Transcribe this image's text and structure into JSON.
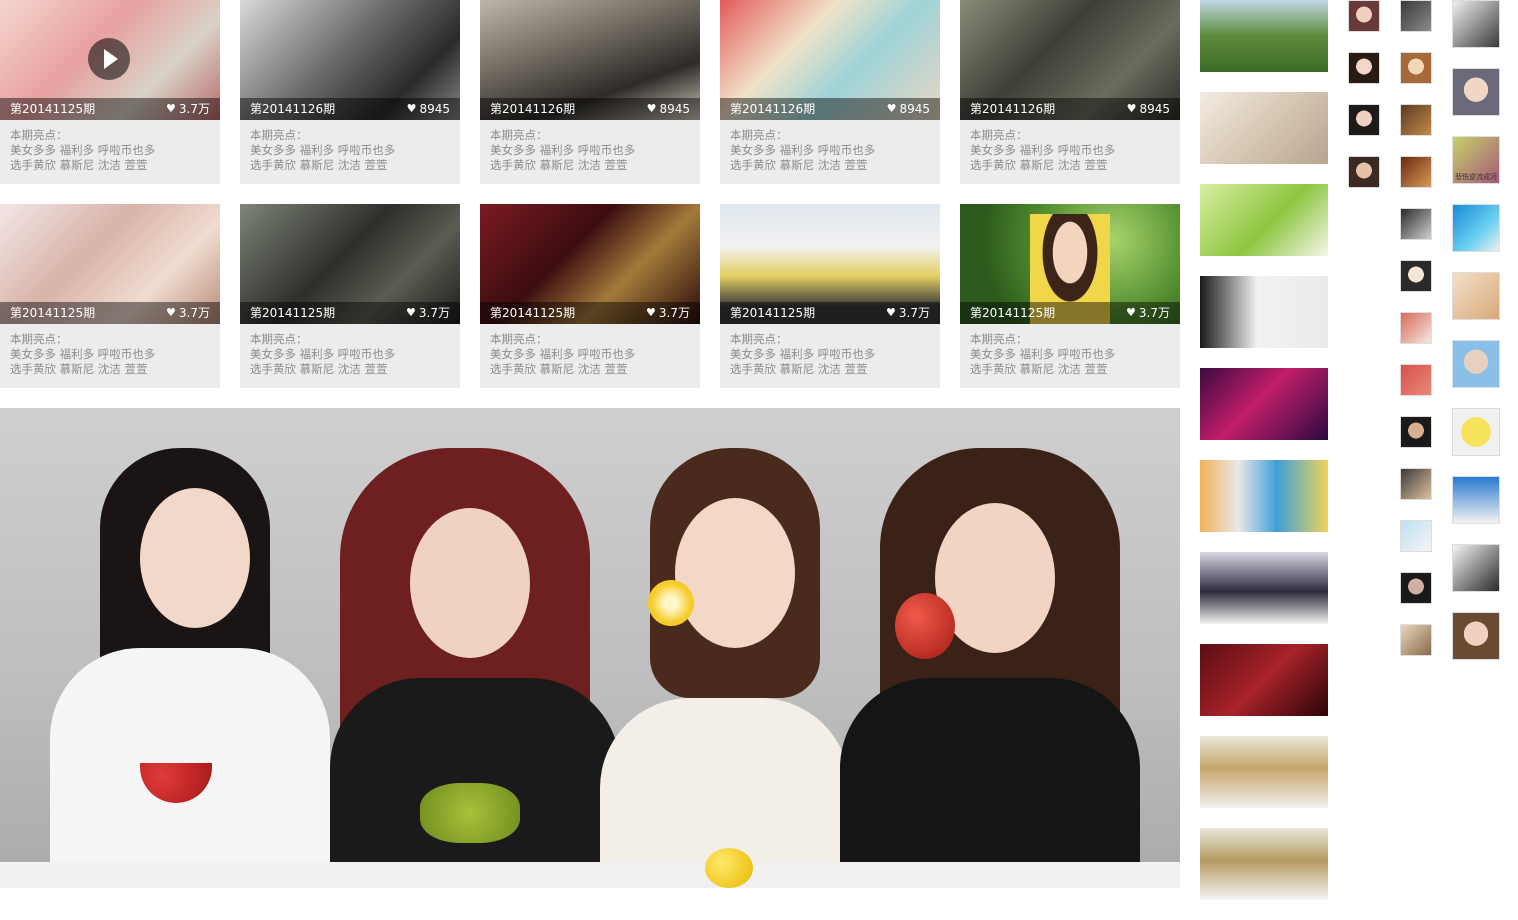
{
  "grid": {
    "row1": [
      {
        "episode": "第20141125期",
        "likes": "3.7万",
        "desc_title": "本期亮点：",
        "desc_line1": "美女多多 福利多 呼啦币也多",
        "desc_line2": "选手黄欣 慕斯尼 沈洁 萱萱",
        "has_play": true
      },
      {
        "episode": "第20141126期",
        "likes": "8945",
        "desc_title": "本期亮点：",
        "desc_line1": "美女多多 福利多 呼啦币也多",
        "desc_line2": "选手黄欣 慕斯尼 沈洁 萱萱",
        "has_play": false
      },
      {
        "episode": "第20141126期",
        "likes": "8945",
        "desc_title": "本期亮点：",
        "desc_line1": "美女多多 福利多 呼啦币也多",
        "desc_line2": "选手黄欣 慕斯尼 沈洁 萱萱",
        "has_play": false
      },
      {
        "episode": "第20141126期",
        "likes": "8945",
        "desc_title": "本期亮点：",
        "desc_line1": "美女多多 福利多 呼啦币也多",
        "desc_line2": "选手黄欣 慕斯尼 沈洁 萱萱",
        "has_play": false
      },
      {
        "episode": "第20141126期",
        "likes": "8945",
        "desc_title": "本期亮点：",
        "desc_line1": "美女多多 福利多 呼啦币也多",
        "desc_line2": "选手黄欣 慕斯尼 沈洁 萱萱",
        "has_play": false
      }
    ],
    "row2": [
      {
        "episode": "第20141125期",
        "likes": "3.7万",
        "desc_title": "本期亮点：",
        "desc_line1": "美女多多 福利多 呼啦币也多",
        "desc_line2": "选手黄欣 慕斯尼 沈洁 萱萱"
      },
      {
        "episode": "第20141125期",
        "likes": "3.7万",
        "desc_title": "本期亮点：",
        "desc_line1": "美女多多 福利多 呼啦币也多",
        "desc_line2": "选手黄欣 慕斯尼 沈洁 萱萱"
      },
      {
        "episode": "第20141125期",
        "likes": "3.7万",
        "desc_title": "本期亮点：",
        "desc_line1": "美女多多 福利多 呼啦币也多",
        "desc_line2": "选手黄欣 慕斯尼 沈洁 萱萱"
      },
      {
        "episode": "第20141125期",
        "likes": "3.7万",
        "desc_title": "本期亮点：",
        "desc_line1": "美女多多 福利多 呼啦币也多",
        "desc_line2": "选手黄欣 慕斯尼 沈洁 萱萱"
      },
      {
        "episode": "第20141125期",
        "likes": "3.7万",
        "desc_title": "本期亮点：",
        "desc_line1": "美女多多 福利多 呼啦币也多",
        "desc_line2": "选手黄欣 慕斯尼 沈洁 萱萱"
      }
    ]
  },
  "icons": {
    "like": "heart-icon",
    "play": "play-icon"
  },
  "avatar_caption": "悲伤逆流成河",
  "colors": {
    "card_bg": "#ececec",
    "desc_text": "#8c8c8c",
    "overlay": "rgba(0,0,0,0.45)"
  }
}
